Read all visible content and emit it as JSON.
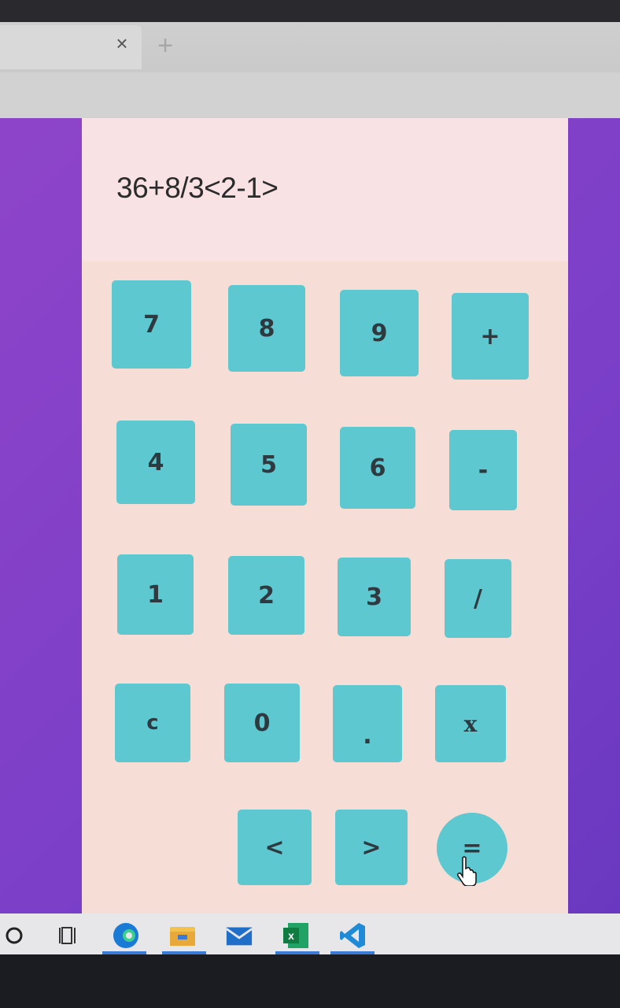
{
  "browser": {
    "tab_close_icon": "close-icon",
    "new_tab_icon": "plus-icon",
    "tab_close_glyph": "×",
    "new_tab_glyph": "+"
  },
  "calculator": {
    "display": "36+8/3<2-1>",
    "keys": [
      [
        "7",
        "8",
        "9",
        "+"
      ],
      [
        "4",
        "5",
        "6",
        "-"
      ],
      [
        "1",
        "2",
        "3",
        "/"
      ],
      [
        "c",
        "0",
        ".",
        "x"
      ],
      [
        "<",
        ">",
        "="
      ]
    ]
  },
  "taskbar": {
    "items": [
      "search-circle-icon",
      "task-view-icon",
      "edge-icon",
      "file-explorer-icon",
      "mail-icon",
      "excel-icon",
      "vscode-icon"
    ]
  },
  "colors": {
    "background_purple": "#8e44c9",
    "calculator_bg": "#f6ddd5",
    "display_bg": "#f8e2e4",
    "key_teal": "#5dc8d0",
    "key_text": "#2f3a40"
  }
}
